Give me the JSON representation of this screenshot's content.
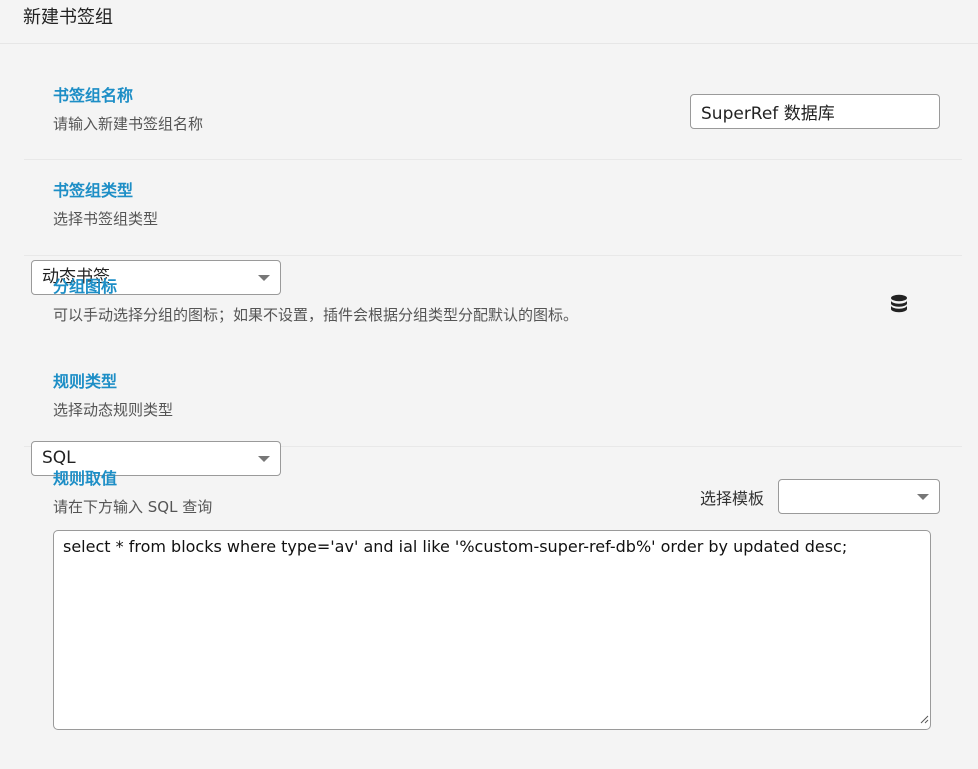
{
  "dialog": {
    "title": "新建书签组"
  },
  "name_row": {
    "title": "书签组名称",
    "desc": "请输入新建书签组名称",
    "value": "SuperRef 数据库"
  },
  "type_row": {
    "title": "书签组类型",
    "desc": "选择书签组类型",
    "selected": "动态书签"
  },
  "icon_row": {
    "title": "分组图标",
    "desc": "可以手动选择分组的图标；如果不设置，插件会根据分组类型分配默认的图标。",
    "icon": "database-icon"
  },
  "rule_type_row": {
    "title": "规则类型",
    "desc": "选择动态规则类型",
    "selected": "SQL"
  },
  "rule_value_row": {
    "title": "规则取值",
    "desc": "请在下方输入 SQL 查询",
    "template_label": "选择模板",
    "template_selected": "",
    "query": "select * from blocks where type='av' and ial like '%custom-super-ref-db%' order by updated desc;"
  }
}
